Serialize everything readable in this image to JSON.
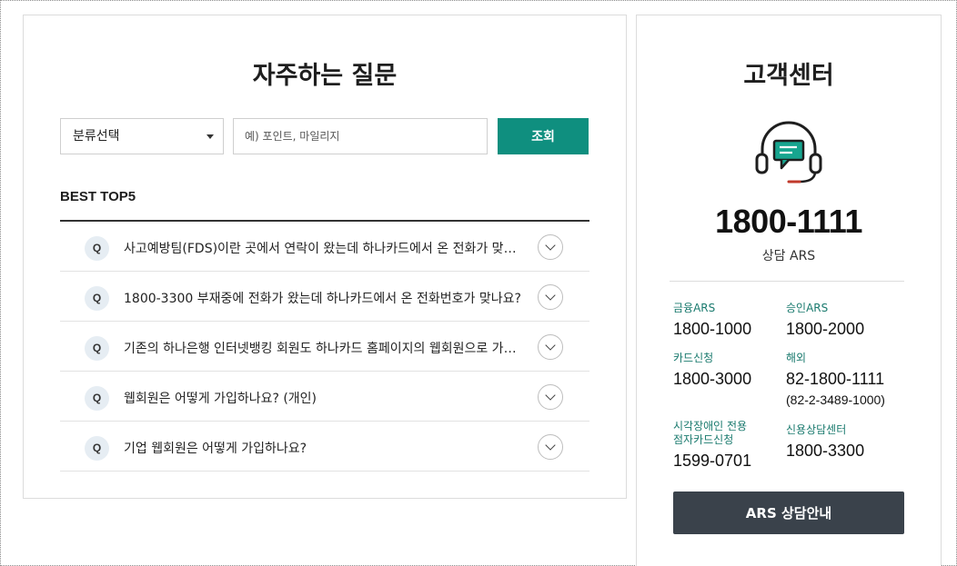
{
  "faq": {
    "title": "자주하는 질문",
    "category_select": {
      "value": "분류선택"
    },
    "search": {
      "placeholder": "예) 포인트, 마일리지",
      "value": ""
    },
    "search_button": "조회",
    "best_label": "BEST TOP5",
    "items": [
      {
        "badge": "Q",
        "text": "사고예방팀(FDS)이란 곳에서 연락이 왔는데 하나카드에서 온 전화가 맞나요?"
      },
      {
        "badge": "Q",
        "text": "1800-3300 부재중에 전화가 왔는데 하나카드에서 온 전화번호가 맞나요?"
      },
      {
        "badge": "Q",
        "text": "기존의 하나은행 인터넷뱅킹 회원도 하나카드 홈페이지의 웹회원으로 가입해야 하나요?"
      },
      {
        "badge": "Q",
        "text": "웹회원은 어떻게 가입하나요? (개인)"
      },
      {
        "badge": "Q",
        "text": "기업 웹회원은 어떻게 가입하나요?"
      }
    ]
  },
  "customer_center": {
    "title": "고객센터",
    "icon": "headset-chat-icon",
    "main_phone": "1800-1111",
    "main_label": "상담 ARS",
    "contacts": [
      {
        "label": "금융ARS",
        "number": "1800-1000"
      },
      {
        "label": "승인ARS",
        "number": "1800-2000"
      },
      {
        "label": "카드신청",
        "number": "1800-3000"
      },
      {
        "label": "해외",
        "number": "82-1800-1111",
        "sub": "(82-2-3489-1000)"
      },
      {
        "label_line1": "시각장애인 전용",
        "label_line2": "점자카드신청",
        "number": "1599-0701"
      },
      {
        "label": "신용상담센터",
        "number": "1800-3300"
      }
    ],
    "ars_button": "ARS 상담안내"
  },
  "colors": {
    "accent": "#0f8f7f",
    "label_green": "#1a7a6e",
    "dark_button": "#3a424b",
    "q_badge_bg": "#e6edf3"
  }
}
